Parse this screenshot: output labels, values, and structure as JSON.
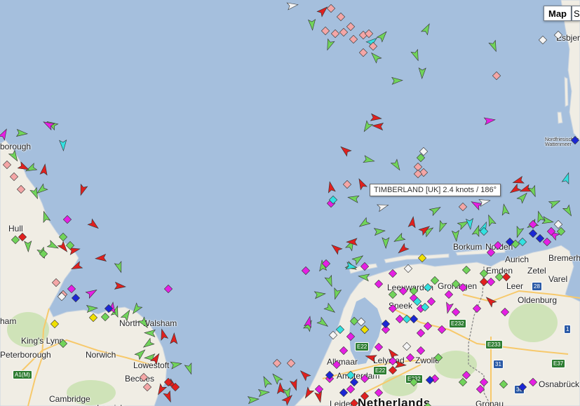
{
  "map": {
    "type_buttons": [
      "Map",
      "S"
    ],
    "tooltip": "TIMBERLAND [UK] 2.4 knots / 186°",
    "colors": {
      "sea": "#a5bfdd",
      "land": "#f0ede4",
      "green_area": "#cfe3b8",
      "ship_cargo": "#71d45a",
      "ship_tanker": "#e0201e",
      "ship_passenger": "#1b27d4",
      "ship_other": "#e51fe3",
      "ship_tug": "#33e0e0",
      "ship_fishing": "#f4a6a6",
      "ship_yacht": "#f0e000",
      "ship_unknown": "#cccccc"
    },
    "places": [
      {
        "name": "Hull",
        "cls": ""
      },
      {
        "name": "Peterborough",
        "cls": ""
      },
      {
        "name": "King's Lynn",
        "cls": ""
      },
      {
        "name": "Norwich",
        "cls": ""
      },
      {
        "name": "North Walsham",
        "cls": ""
      },
      {
        "name": "Lowestoft",
        "cls": ""
      },
      {
        "name": "Beccles",
        "cls": ""
      },
      {
        "name": "Cambridge",
        "cls": ""
      },
      {
        "name": "Ipswich",
        "cls": ""
      },
      {
        "name": "ham",
        "cls": ""
      },
      {
        "name": "borough",
        "cls": ""
      },
      {
        "name": "Leeuwarden",
        "cls": ""
      },
      {
        "name": "Groningen",
        "cls": ""
      },
      {
        "name": "Sneek",
        "cls": ""
      },
      {
        "name": "Zwolle",
        "cls": ""
      },
      {
        "name": "Lelystad",
        "cls": ""
      },
      {
        "name": "Alkmaar",
        "cls": ""
      },
      {
        "name": "Amsterdam",
        "cls": ""
      },
      {
        "name": "Leiden",
        "cls": ""
      },
      {
        "name": "Netherlands",
        "cls": "big"
      },
      {
        "name": "Emden",
        "cls": ""
      },
      {
        "name": "Aurich",
        "cls": ""
      },
      {
        "name": "Leer",
        "cls": ""
      },
      {
        "name": "Oldenburg",
        "cls": ""
      },
      {
        "name": "Bremerhaven",
        "cls": ""
      },
      {
        "name": "Varel",
        "cls": ""
      },
      {
        "name": "Zetel",
        "cls": ""
      },
      {
        "name": "Borkum",
        "cls": ""
      },
      {
        "name": "Norden",
        "cls": ""
      },
      {
        "name": "Osnabrück",
        "cls": ""
      },
      {
        "name": "Gronau",
        "cls": ""
      },
      {
        "name": "Esbjerg",
        "cls": ""
      },
      {
        "name": "Nordfriesisches Wattenmeer",
        "cls": "small"
      }
    ],
    "roads": [
      {
        "label": "A1(M)",
        "cls": "green"
      },
      {
        "label": "E22",
        "cls": "green"
      },
      {
        "label": "E22",
        "cls": "green"
      },
      {
        "label": "E232",
        "cls": "green"
      },
      {
        "label": "E232",
        "cls": "green"
      },
      {
        "label": "E233",
        "cls": "green"
      },
      {
        "label": "E37",
        "cls": "green"
      },
      {
        "label": "28",
        "cls": "blue"
      },
      {
        "label": "31",
        "cls": "blue"
      },
      {
        "label": "30",
        "cls": "blue"
      },
      {
        "label": "1",
        "cls": "blue"
      }
    ]
  }
}
